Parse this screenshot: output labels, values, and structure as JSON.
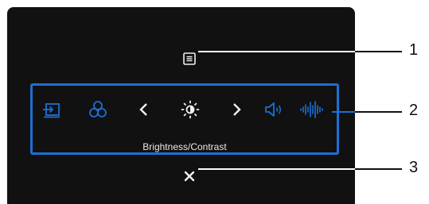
{
  "osd": {
    "menu_icon": "menu-list-icon",
    "close_icon": "close-icon",
    "shortcut": {
      "label": "Brightness/Contrast",
      "icons": [
        "input-source-icon",
        "color-circles-icon",
        "chevron-left-icon",
        "brightness-icon",
        "chevron-right-icon",
        "volume-icon",
        "audio-waveform-icon"
      ]
    }
  },
  "callouts": [
    "1",
    "2",
    "3"
  ],
  "colors": {
    "accent_blue": "#1d6fd6",
    "panel_bg": "#111111",
    "icon_white": "#f0f0f0"
  }
}
